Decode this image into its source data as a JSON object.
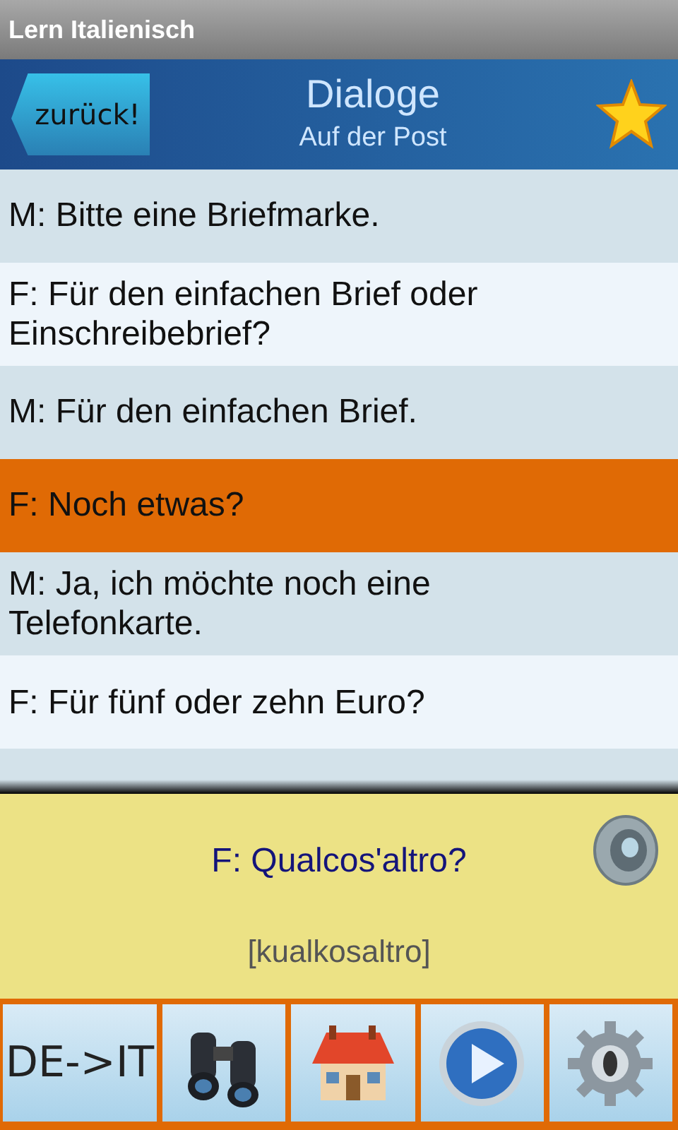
{
  "app_title": "Lern Italienisch",
  "header": {
    "back": "zurück!",
    "title": "Dialoge",
    "subtitle": "Auf der Post"
  },
  "rows": [
    {
      "text": "M: Bitte eine Briefmarke.",
      "selected": false
    },
    {
      "text": "F: Für den einfachen Brief oder Einschreibebrief?",
      "selected": false
    },
    {
      "text": "M: Für den einfachen Brief.",
      "selected": false
    },
    {
      "text": "F: Noch etwas?",
      "selected": true
    },
    {
      "text": "M: Ja, ich möchte noch eine Telefonkarte.",
      "selected": false
    },
    {
      "text": "F: Für fünf oder zehn Euro?",
      "selected": false
    }
  ],
  "translation": {
    "text": "F: Qualcos'altro?",
    "pronunciation": "[kualkosaltro]"
  },
  "toolbar": [
    {
      "kind": "text",
      "label": "DE->IT"
    },
    {
      "kind": "binoculars"
    },
    {
      "kind": "house"
    },
    {
      "kind": "play"
    },
    {
      "kind": "gear"
    }
  ]
}
